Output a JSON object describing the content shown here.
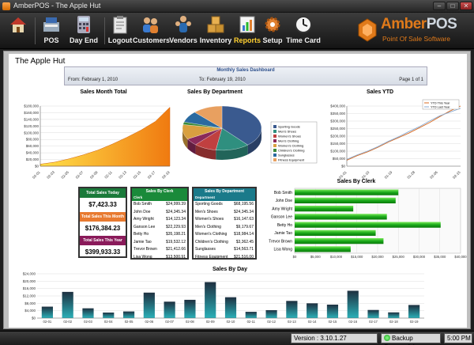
{
  "window": {
    "title": "AmberPOS - The Apple Hut",
    "minimize": "–",
    "maximize": "□",
    "close": "✕"
  },
  "toolbar": {
    "buttons": [
      {
        "label": "",
        "icon": "home-icon"
      },
      {
        "label": "POS",
        "icon": "register-icon"
      },
      {
        "label": "Day End",
        "icon": "calculator-icon"
      },
      {
        "label": "Logout",
        "icon": "clipboard-icon"
      },
      {
        "label": "Customers",
        "icon": "customers-icon"
      },
      {
        "label": "Vendors",
        "icon": "vendors-icon"
      },
      {
        "label": "Inventory",
        "icon": "boxes-icon"
      },
      {
        "label": "Reports",
        "icon": "reports-icon",
        "active": true
      },
      {
        "label": "Setup",
        "icon": "gear-icon"
      },
      {
        "label": "Time Card",
        "icon": "clock-icon"
      }
    ]
  },
  "logo": {
    "brand_a": "Amber",
    "brand_b": "POS",
    "tagline": "Point Of Sale Software"
  },
  "report": {
    "store": "The Apple Hut",
    "dashboard_title": "Monthly Sales Dashboard",
    "from": "From: February 1, 2010",
    "to": "To: February 19, 2010",
    "page": "Page 1 of 1"
  },
  "charts": {
    "month_total": {
      "title": "Sales Month Total",
      "type": "area",
      "y_ticks": [
        "$180,000",
        "$160,000",
        "$140,000",
        "$120,000",
        "$100,000",
        "$80,000",
        "$60,000",
        "$40,000",
        "$20,000",
        "$0"
      ],
      "x": [
        "02-01",
        "02-03",
        "02-05",
        "02-07",
        "02-09",
        "02-11",
        "02-13",
        "02-15",
        "02-17",
        "02-19"
      ],
      "values": [
        6000,
        12000,
        22000,
        34000,
        48000,
        66000,
        86000,
        108000,
        134000,
        176400
      ],
      "ylim": [
        0,
        180000
      ]
    },
    "by_department": {
      "title": "Sales By Department",
      "type": "pie",
      "slices": [
        {
          "name": "Sporting Goods",
          "value": 68195.56,
          "color": "#3a5a8f"
        },
        {
          "name": "Men's Shoes",
          "value": 24345.34,
          "color": "#2f8f7f"
        },
        {
          "name": "Women's Shoes",
          "value": 16147.63,
          "color": "#c04040"
        },
        {
          "name": "Men's Clothing",
          "value": 9179.67,
          "color": "#8a2a5a"
        },
        {
          "name": "Women's Clothing",
          "value": 18984.14,
          "color": "#d9a040"
        },
        {
          "name": "Children's Clothing",
          "value": 3362.45,
          "color": "#3a8a3a"
        },
        {
          "name": "Sunglasses",
          "value": 14563.71,
          "color": "#2a6aa0"
        },
        {
          "name": "Fitness Equipment",
          "value": 21516.0,
          "color": "#e8a060"
        }
      ]
    },
    "ytd": {
      "title": "Sales YTD",
      "type": "line",
      "legend": [
        "YTD This Year",
        "YTD Last Year"
      ],
      "y_ticks": [
        "$400,000",
        "$350,000",
        "$300,000",
        "$250,000",
        "$200,000",
        "$150,000",
        "$100,000",
        "$50,000",
        "$0"
      ],
      "x": [
        "01-01",
        "01-10",
        "01-19",
        "01-28",
        "02-06",
        "02-15"
      ],
      "series": [
        {
          "name": "YTD This Year",
          "color": "#d96a20",
          "values": [
            40000,
            70000,
            95000,
            125000,
            160000,
            190000,
            220000,
            255000,
            290000,
            330000,
            368000,
            399933
          ]
        },
        {
          "name": "YTD Last Year",
          "color": "#8aaad0",
          "values": [
            45000,
            75000,
            100000,
            130000,
            165000,
            195000,
            230000,
            262000,
            300000,
            335000,
            360000,
            385000
          ]
        }
      ],
      "ylim": [
        0,
        400000
      ]
    },
    "by_clerk": {
      "title": "Sales By Clerk",
      "type": "bar",
      "categories": [
        "Bob Smith",
        "John Doe",
        "Amy Wright",
        "Ganson Lee",
        "Betty Ho",
        "Jamie Tao",
        "Trevor Brown",
        "Lisa Wong"
      ],
      "values": [
        24999.39,
        24345.34,
        14123.34,
        22229.93,
        35198.21,
        19532.12,
        21412.66,
        13500.91
      ],
      "x_ticks": [
        "$0",
        "$5,000",
        "$10,000",
        "$15,000",
        "$20,000",
        "$25,000",
        "$30,000",
        "$35,000",
        "$40,000"
      ],
      "xlim": [
        0,
        40000
      ]
    },
    "by_day": {
      "title": "Sales By Day",
      "type": "bar",
      "categories": [
        "02-01",
        "02-02",
        "02-03",
        "02-04",
        "02-05",
        "02-06",
        "02-07",
        "02-08",
        "02-09",
        "02-10",
        "02-11",
        "02-12",
        "02-13",
        "02-14",
        "02-15",
        "02-16",
        "02-17",
        "02-18",
        "02-19"
      ],
      "values": [
        6200,
        14200,
        5300,
        3000,
        3600,
        13800,
        8900,
        9900,
        19500,
        11300,
        3400,
        4300,
        9300,
        8000,
        7300,
        14800,
        4400,
        3100,
        7100
      ],
      "y_ticks": [
        "$24,000",
        "$20,000",
        "$16,000",
        "$12,000",
        "$8,000",
        "$4,000",
        "$0"
      ],
      "ylim": [
        0,
        24000
      ]
    }
  },
  "totals": {
    "today_label": "Total Sales Today",
    "today_value": "$7,423.33",
    "month_label": "Total Sales This Month",
    "month_value": "$176,384.23",
    "year_label": "Total Sales This Year",
    "year_value": "$399,933.33"
  },
  "by_clerk_table": {
    "title": "Sales By Clerk",
    "col1": "Clerk",
    "col2": "",
    "rows": [
      {
        "name": "Bob Smith",
        "value": "$24,999.39"
      },
      {
        "name": "John Doe",
        "value": "$24,345.34"
      },
      {
        "name": "Amy Wright",
        "value": "$14,123.34"
      },
      {
        "name": "Ganson Lee",
        "value": "$22,229.93"
      },
      {
        "name": "Betty Ho",
        "value": "$35,198.21"
      },
      {
        "name": "Jamie Tao",
        "value": "$19,532.12"
      },
      {
        "name": "Trevor Brown",
        "value": "$21,412.66"
      },
      {
        "name": "Lisa Wong",
        "value": "$13,500.91"
      }
    ]
  },
  "by_dept_table": {
    "title": "Sales By Department",
    "col1": "Department",
    "col2": "",
    "rows": [
      {
        "name": "Sporting Goods",
        "value": "$68,195.56"
      },
      {
        "name": "Men's Shoes",
        "value": "$24,345.34"
      },
      {
        "name": "Women's Shoes",
        "value": "$16,147.63"
      },
      {
        "name": "Men's Clothing",
        "value": "$9,179.67"
      },
      {
        "name": "Women's Clothing",
        "value": "$18,984.14"
      },
      {
        "name": "Children's Clothing",
        "value": "$3,362.45"
      },
      {
        "name": "Sunglasses",
        "value": "$14,563.71"
      },
      {
        "name": "Fitness Equipment",
        "value": "$21,516.00"
      }
    ]
  },
  "status": {
    "version": "Version : 3.10.1.27",
    "backup": "Backup Successful",
    "time": "5:00 PM"
  },
  "colors": {
    "totals_header": "#1a7a3a",
    "totals_month": "#e87a30",
    "totals_year": "#8a1a5a",
    "clerk_header": "#1a8a3a",
    "dept_header": "#1a7a8a",
    "day_bar": "#1a7a8a",
    "clerk_bar": "#2ab82a"
  }
}
